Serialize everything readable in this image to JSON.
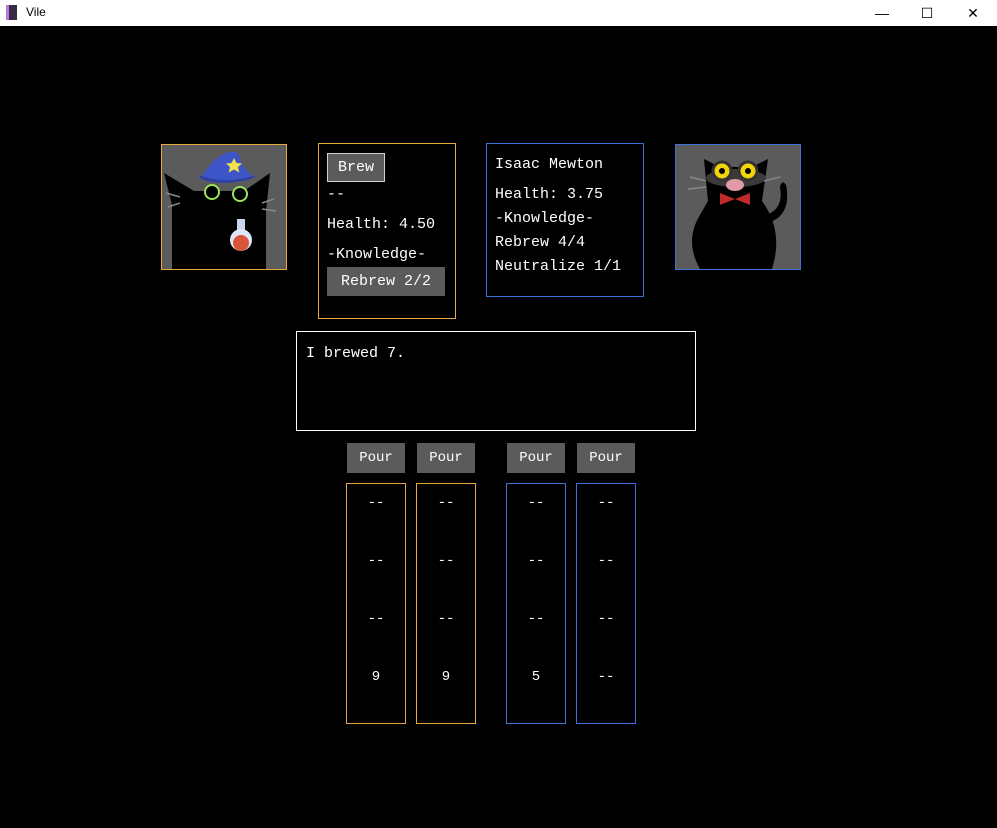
{
  "window": {
    "title": "Vile",
    "controls": {
      "minimize": "—",
      "maximize": "☐",
      "close": "✕"
    }
  },
  "colors": {
    "player": "#e6a83f",
    "opponent": "#3f6fd8",
    "button": "#5b5b5b"
  },
  "player": {
    "brew_label": "Brew",
    "potion": "--",
    "health": "Health: 4.50",
    "knowledge_header": "-Knowledge-",
    "rebrew_label": "Rebrew 2/2",
    "portrait_icon": "wizard-cat-icon"
  },
  "opponent": {
    "name": "Isaac Mewton",
    "health": "Health: 3.75",
    "knowledge_header": "-Knowledge-",
    "rebrew": "Rebrew 4/4",
    "neutralize": "Neutralize 1/1",
    "portrait_icon": "scientist-cat-icon"
  },
  "message": "I brewed 7.",
  "pour_label": "Pour",
  "columns": [
    {
      "side": "player",
      "cells": [
        "--",
        "--",
        "--",
        "9"
      ]
    },
    {
      "side": "player",
      "cells": [
        "--",
        "--",
        "--",
        "9"
      ]
    },
    {
      "side": "opponent",
      "cells": [
        "--",
        "--",
        "--",
        "5"
      ]
    },
    {
      "side": "opponent",
      "cells": [
        "--",
        "--",
        "--",
        "--"
      ]
    }
  ]
}
